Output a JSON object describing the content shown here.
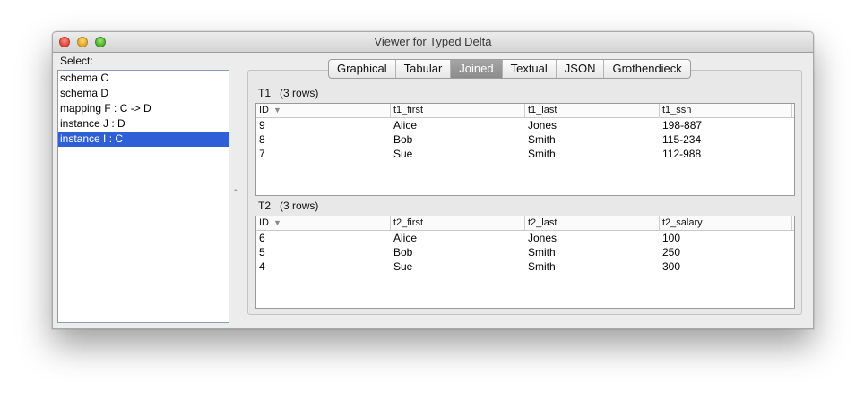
{
  "window": {
    "title": "Viewer for Typed Delta"
  },
  "sidebar": {
    "label": "Select:",
    "items": [
      {
        "label": "schema C",
        "selected": false
      },
      {
        "label": "schema D",
        "selected": false
      },
      {
        "label": "mapping F : C -> D",
        "selected": false
      },
      {
        "label": "instance J : D",
        "selected": false
      },
      {
        "label": "instance I : C",
        "selected": true
      }
    ]
  },
  "tabs": [
    {
      "label": "Graphical",
      "active": false
    },
    {
      "label": "Tabular",
      "active": false
    },
    {
      "label": "Joined",
      "active": true
    },
    {
      "label": "Textual",
      "active": false
    },
    {
      "label": "JSON",
      "active": false
    },
    {
      "label": "Grothendieck",
      "active": false
    }
  ],
  "tables": [
    {
      "name": "T1",
      "row_count": "(3 rows)",
      "columns": [
        "ID",
        "t1_first",
        "t1_last",
        "t1_ssn"
      ],
      "rows": [
        [
          "9",
          "Alice",
          "Jones",
          "198-887"
        ],
        [
          "8",
          "Bob",
          "Smith",
          "115-234"
        ],
        [
          "7",
          "Sue",
          "Smith",
          "112-988"
        ]
      ]
    },
    {
      "name": "T2",
      "row_count": "(3 rows)",
      "columns": [
        "ID",
        "t2_first",
        "t2_last",
        "t2_salary"
      ],
      "rows": [
        [
          "6",
          "Alice",
          "Jones",
          "100"
        ],
        [
          "5",
          "Bob",
          "Smith",
          "250"
        ],
        [
          "4",
          "Sue",
          "Smith",
          "300"
        ]
      ]
    }
  ],
  "colors": {
    "selection": "#2f5fd6",
    "active_tab": "#999999"
  }
}
